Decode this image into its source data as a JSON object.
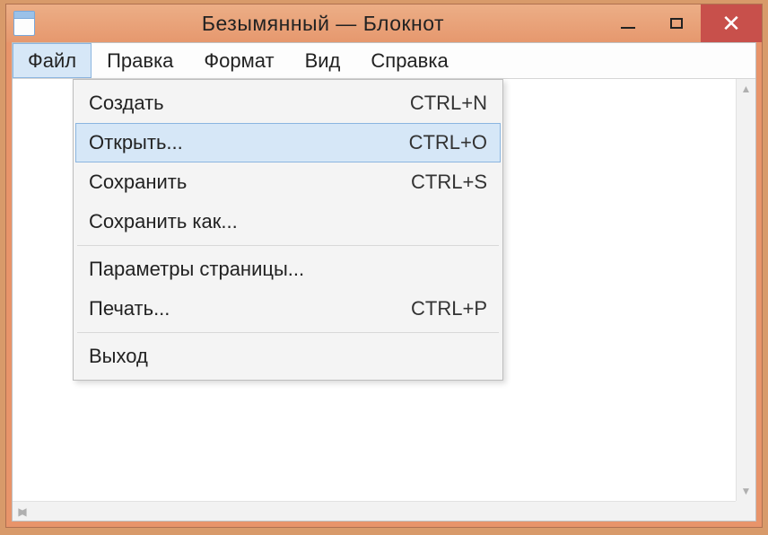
{
  "window": {
    "title": "Безымянный — Блокнот"
  },
  "menubar": {
    "items": [
      {
        "label": "Файл",
        "active": true
      },
      {
        "label": "Правка",
        "active": false
      },
      {
        "label": "Формат",
        "active": false
      },
      {
        "label": "Вид",
        "active": false
      },
      {
        "label": "Справка",
        "active": false
      }
    ]
  },
  "dropdown": {
    "items": [
      {
        "label": "Создать",
        "shortcut": "CTRL+N",
        "hover": false
      },
      {
        "label": "Открыть...",
        "shortcut": "CTRL+O",
        "hover": true
      },
      {
        "label": "Сохранить",
        "shortcut": "CTRL+S",
        "hover": false
      },
      {
        "label": "Сохранить как...",
        "shortcut": "",
        "hover": false
      },
      {
        "sep": true
      },
      {
        "label": "Параметры страницы...",
        "shortcut": "",
        "hover": false
      },
      {
        "label": "Печать...",
        "shortcut": "CTRL+P",
        "hover": false
      },
      {
        "sep": true
      },
      {
        "label": "Выход",
        "shortcut": "",
        "hover": false
      }
    ]
  }
}
